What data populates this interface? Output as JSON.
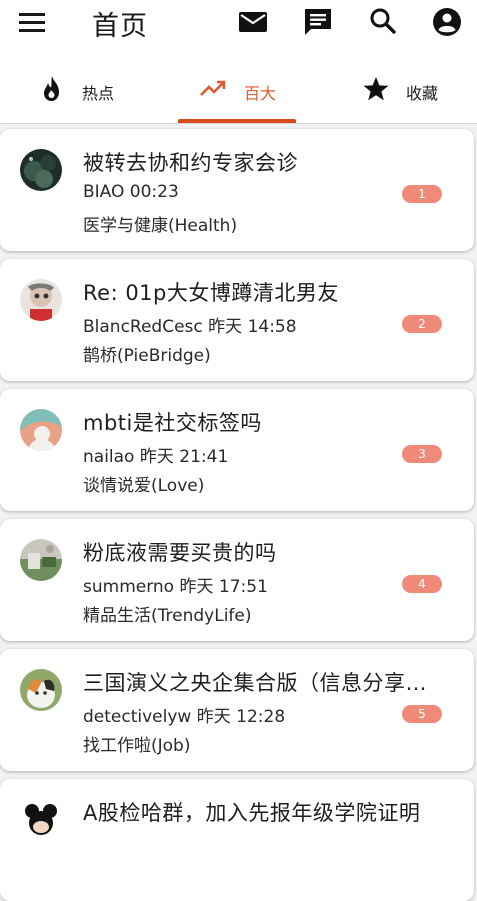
{
  "header": {
    "title": "首页",
    "icons": [
      "menu-icon",
      "mail-icon",
      "message-icon",
      "search-icon",
      "account-icon"
    ]
  },
  "tabs": [
    {
      "label": "热点",
      "icon": "fire-icon"
    },
    {
      "label": "百大",
      "icon": "trending-up-icon"
    },
    {
      "label": "收藏",
      "icon": "star-icon"
    }
  ],
  "active_tab": "百大",
  "colors": {
    "accent": "#d84a1c",
    "badge": "#f08a78"
  },
  "posts": [
    {
      "title": "被转去协和约专家会诊",
      "author": "BIAO",
      "time": "00:23",
      "board": "医学与健康(Health)",
      "rank": "1"
    },
    {
      "title": "Re: 01p大女博蹲清北男友",
      "author": "BlancRedCesc",
      "time": "昨天 14:58",
      "board": "鹊桥(PieBridge)",
      "rank": "2"
    },
    {
      "title": "mbti是社交标签吗",
      "author": "nailao",
      "time": "昨天 21:41",
      "board": "谈情说爱(Love)",
      "rank": "3"
    },
    {
      "title": "粉底液需要买贵的吗",
      "author": "summerno",
      "time": "昨天 17:51",
      "board": "精品生活(TrendyLife)",
      "rank": "4"
    },
    {
      "title": "三国演义之央企集合版（信息分享…",
      "author": "detectivelyw",
      "time": "昨天 12:28",
      "board": "找工作啦(Job)",
      "rank": "5"
    },
    {
      "title": "A股检哈群，加入先报年级学院证明",
      "author": "",
      "time": "",
      "board": "",
      "rank": ""
    }
  ]
}
